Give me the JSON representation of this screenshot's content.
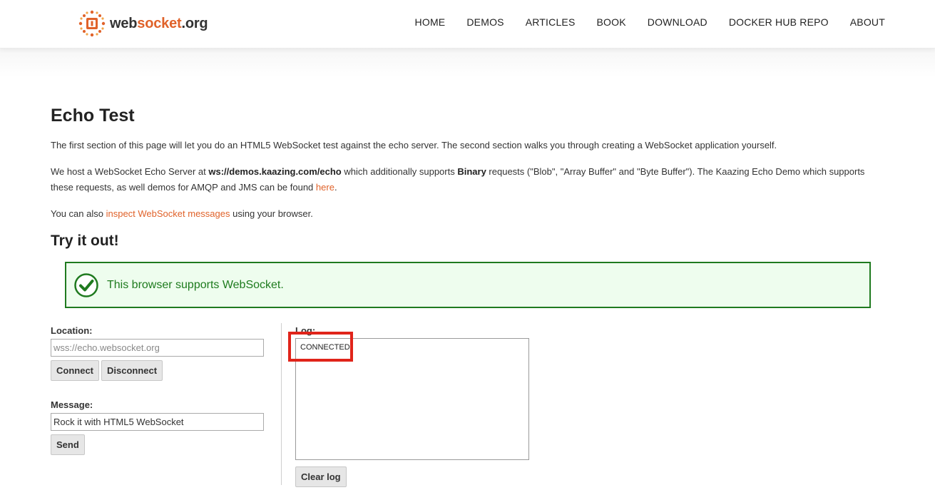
{
  "header": {
    "logo_text_part1": "web",
    "logo_text_part2": "socket",
    "logo_text_part3": ".org",
    "nav": [
      {
        "label": "HOME"
      },
      {
        "label": "DEMOS"
      },
      {
        "label": "ARTICLES"
      },
      {
        "label": "BOOK"
      },
      {
        "label": "DOWNLOAD"
      },
      {
        "label": "DOCKER HUB REPO"
      },
      {
        "label": "ABOUT"
      }
    ]
  },
  "main": {
    "title": "Echo Test",
    "intro": "The first section of this page will let you do an HTML5 WebSocket test against the echo server. The second section walks you through creating a WebSocket application yourself.",
    "host_prefix": "We host a WebSocket Echo Server at ",
    "host_url": "ws://demos.kaazing.com/echo",
    "host_mid": " which additionally supports ",
    "host_binary": "Binary",
    "host_rest": " requests (\"Blob\", \"Array Buffer\" and \"Byte Buffer\"). The Kaazing Echo Demo which supports these requests, as well demos for AMQP and JMS can be found ",
    "host_link": "here",
    "host_end": ".",
    "inspect_prefix": "You can also ",
    "inspect_link": "inspect WebSocket messages",
    "inspect_suffix": " using your browser.",
    "try_title": "Try it out!",
    "support_message": "This browser supports WebSocket."
  },
  "form": {
    "location_label": "Location:",
    "location_placeholder": "wss://echo.websocket.org",
    "connect_label": "Connect",
    "disconnect_label": "Disconnect",
    "message_label": "Message:",
    "message_value": "Rock it with HTML5 WebSocket",
    "send_label": "Send"
  },
  "log": {
    "label": "Log:",
    "entries": [
      "CONNECTED"
    ],
    "clear_label": "Clear log"
  },
  "colors": {
    "accent": "#e0622a",
    "success_border": "#1f7a1f",
    "success_bg": "#eefdee",
    "highlight": "#e0241a"
  }
}
